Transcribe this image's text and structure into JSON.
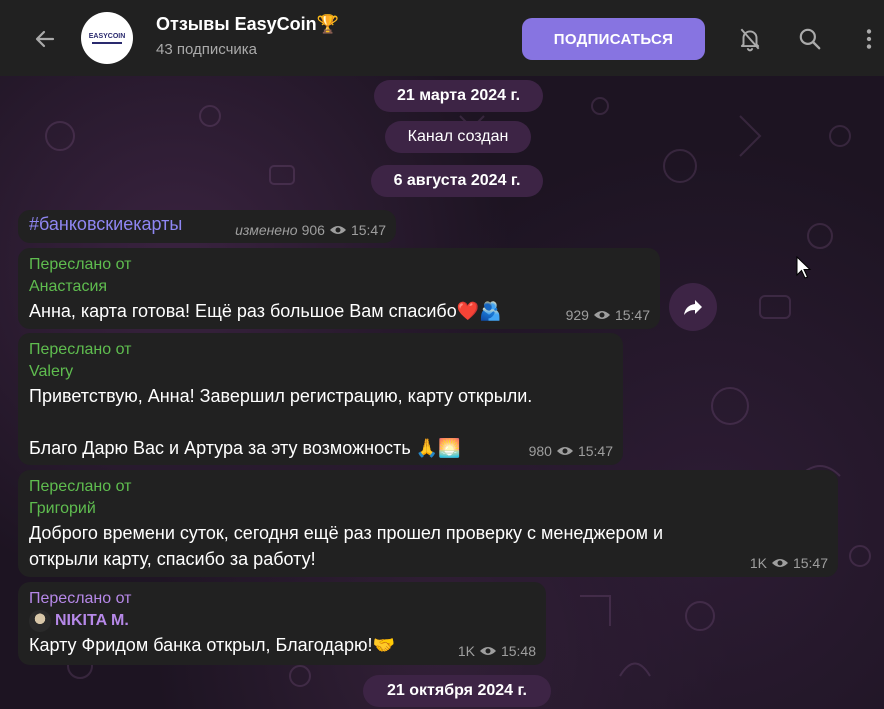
{
  "header": {
    "title": "Отзывы EasyCoin🏆",
    "subtitle": "43 подписчика",
    "subscribe_label": "ПОДПИСАТЬСЯ",
    "avatar_text": "EASYCOIN"
  },
  "pills": {
    "date1": "21 марта 2024 г.",
    "service": "Канал создан",
    "date2": "6 августа 2024 г.",
    "date3": "21 октября 2024 г."
  },
  "messages": [
    {
      "hashtag": "#банковскиекарты",
      "edited": "изменено",
      "views": "906",
      "time": "15:47"
    },
    {
      "forwarded_label": "Переслано от",
      "from": "Анастасия",
      "text": "Анна, карта готова! Ещё раз большое Вам спасибо❤️🫂",
      "views": "929",
      "time": "15:47"
    },
    {
      "forwarded_label": "Переслано от",
      "from": "Valery",
      "text1": "Приветствую, Анна! Завершил регистрацию, карту открыли.",
      "text2": "Благо Дарю Вас и Артура за эту возможность 🙏🌅",
      "views": "980",
      "time": "15:47"
    },
    {
      "forwarded_label": "Переслано от",
      "from": "Григорий",
      "text1": "Доброго времени суток, сегодня ещё раз прошел проверку с менеджером и",
      "text2": "открыли карту, спасибо за работу!",
      "views": "1K",
      "time": "15:47"
    },
    {
      "forwarded_label": "Переслано от",
      "from": "NIKITA M.",
      "text": "Карту Фридом банка открыл, Благодарю!🤝",
      "views": "1K",
      "time": "15:48"
    }
  ],
  "colors": {
    "accent": "#8774e1",
    "forward_green": "#5fbd4f",
    "forward_purple": "#b688e8",
    "bubble": "#212121",
    "pill": "#3d2445"
  },
  "icons": [
    "back-arrow-icon",
    "mute-bell-icon",
    "search-icon",
    "more-vertical-icon",
    "eye-icon",
    "share-icon",
    "mouse-cursor-icon"
  ]
}
